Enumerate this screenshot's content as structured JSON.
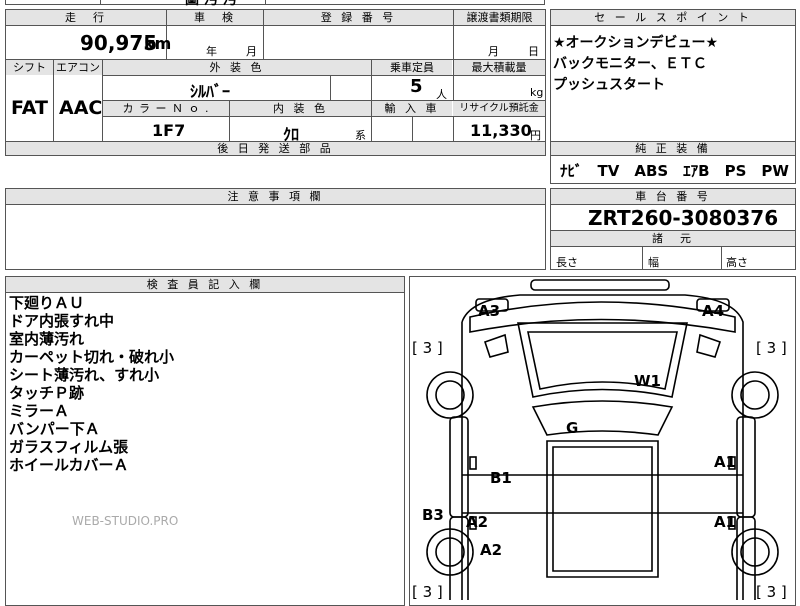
{
  "top_strip": {
    "cut_text_1": "",
    "cut_text_2": "圖 汚 汚"
  },
  "main_table": {
    "headers": {
      "mileage": "走　行",
      "inspection": "車　検",
      "registration_no": "登 録 番 号",
      "transfer_deadline": "譲渡書類期限",
      "shift": "シフト",
      "aircon": "エアコン",
      "exterior_color": "外 装 色",
      "capacity": "乗車定員",
      "max_load": "最大積載量",
      "color_no": "カ ラ ー Ｎ ｏ .",
      "interior_color": "内 装 色",
      "import": "輸 入 車",
      "recycle_fee": "リサイクル預託金",
      "later_parts": "後 日 発 送 部 品"
    },
    "values": {
      "mileage": "90,975",
      "mileage_unit": "km",
      "inspection_year": "年",
      "inspection_month": "月",
      "transfer_month": "月",
      "transfer_day": "日",
      "shift": "FAT",
      "aircon": "AAC",
      "exterior_color": "ｼﾙﾊﾞｰ",
      "capacity": "5",
      "capacity_unit": "人",
      "max_load_unit": "kg",
      "color_no": "1F7",
      "interior_color": "ｸﾛ",
      "interior_suffix": "系",
      "recycle_fee": "11,330",
      "recycle_unit": "円"
    }
  },
  "sales_points": {
    "header": "セ ー ル ス ポ イ ン ト",
    "lines": [
      "★オークションデビュー★",
      "バックモニター、ＥＴＣ",
      "プッシュスタート"
    ]
  },
  "standard_equipment": {
    "header": "純 正 装 備",
    "value": "ﾅﾋﾞ　TV　ABS　ｴｱB　PS　PW"
  },
  "caution": {
    "header": "注 意 事 項 欄"
  },
  "chassis": {
    "header": "車 台 番 号",
    "value": "ZRT260-3080376",
    "dims_header": "諸　元",
    "length_label": "長さ",
    "width_label": "幅",
    "height_label": "高さ"
  },
  "inspector": {
    "header": "検 査 員 記 入 欄",
    "notes": [
      "下廻りＡＵ",
      "ドア内張すれ中",
      "室内薄汚れ",
      "カーペット切れ・破れ小",
      "シート薄汚れ、すれ小",
      "タッチＰ跡",
      "ミラーＡ",
      "バンパー下Ａ",
      "ガラスフィルム張",
      "ホイールカバーＡ"
    ],
    "watermark": "WEB-STUDIO.PRO"
  },
  "diagram": {
    "marks": {
      "a3": "A3",
      "a4": "A4",
      "w1": "W1",
      "g": "G",
      "b1": "B1",
      "b3": "B3",
      "a2_door": "A2",
      "a2_rear": "A2",
      "a1_front": "A1",
      "a1_rear": "A1"
    },
    "tire_labels": {
      "fl": "[ 3 ]",
      "fr": "[ 3 ]",
      "rl": "[ 3 ]",
      "rr": "[ 3 ]"
    }
  }
}
